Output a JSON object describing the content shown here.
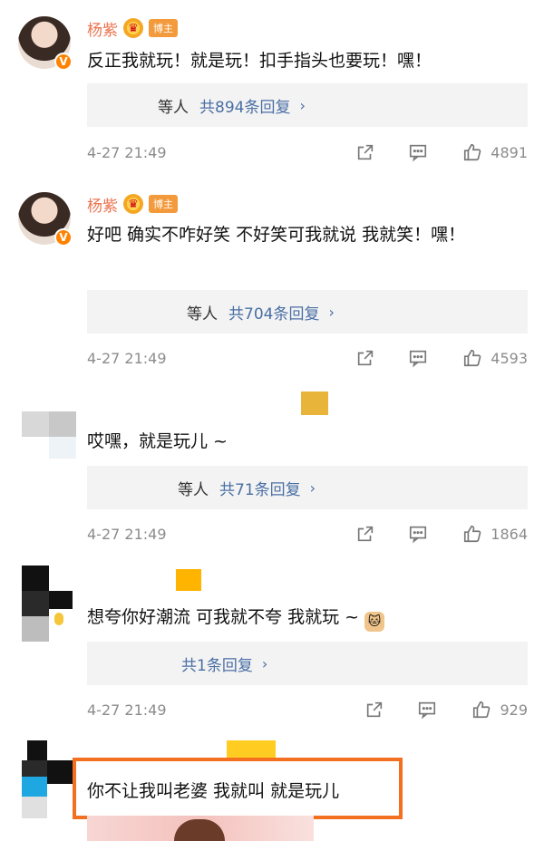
{
  "comments": [
    {
      "username": "杨紫",
      "badge": "博主",
      "text": "反正我就玩！就是玩！扣手指头也要玩！嘿！",
      "reply_prefix": "等人",
      "reply_link": "共894条回复",
      "time": "4-27 21:49",
      "likes": "4891"
    },
    {
      "username": "杨紫",
      "badge": "博主",
      "text": "好吧 确实不咋好笑 不好笑可我就说 我就笑！嘿！",
      "reply_prefix": "等人",
      "reply_link": "共704条回复",
      "time": "4-27 21:49",
      "likes": "4593"
    },
    {
      "username": "",
      "text": "哎嘿，就是玩儿 ~",
      "reply_prefix": "等人",
      "reply_link": "共71条回复",
      "time": "4-27 21:49",
      "likes": "1864"
    },
    {
      "username": "",
      "text": "想夸你好潮流 可我就不夸 我就玩 ~",
      "emoji": "cat-emoji",
      "reply_prefix": "",
      "reply_link": "共1条回复",
      "time": "4-27 21:49",
      "likes": "929"
    },
    {
      "username": "",
      "text": "你不让我叫老婆 我就叫 就是玩儿"
    }
  ],
  "icons": {
    "share": "share-icon",
    "comment": "comment-icon",
    "like": "thumbs-up-icon",
    "chevron": "chevron-right-icon",
    "verify": "verified-v-icon",
    "crown": "crown-icon"
  },
  "colors": {
    "username": "#eb7350",
    "reply_link": "#4a6fa5",
    "highlight_border": "#f37021",
    "meta_text": "#8c8c8c"
  }
}
